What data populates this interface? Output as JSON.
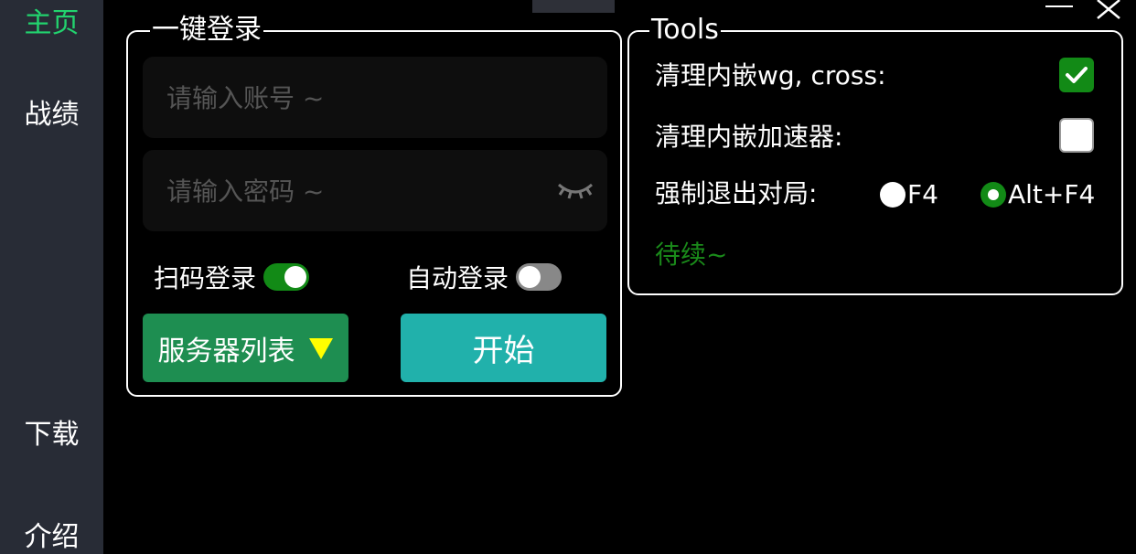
{
  "sidebar": {
    "items": [
      {
        "label": "主页",
        "active": true
      },
      {
        "label": "战绩",
        "active": false
      },
      {
        "label": "下载",
        "active": false
      },
      {
        "label": "介绍",
        "active": false
      }
    ]
  },
  "login": {
    "group_title": "一键登录",
    "account_placeholder": "请输入账号 ~",
    "password_placeholder": "请输入密码 ~",
    "qr_login_label": "扫码登录",
    "qr_login_on": true,
    "auto_login_label": "自动登录",
    "auto_login_on": false,
    "server_list_label": "服务器列表",
    "start_label": "开始"
  },
  "tools": {
    "group_title": "Tools",
    "clean_wg_label": "清理内嵌wg, cross:",
    "clean_wg_checked": true,
    "clean_accel_label": "清理内嵌加速器:",
    "clean_accel_checked": false,
    "force_quit_label": "强制退出对局:",
    "force_quit_options": [
      "F4",
      "Alt+F4"
    ],
    "force_quit_selected": "Alt+F4",
    "pending_label": "待续~"
  },
  "colors": {
    "accent_green": "#22d36e",
    "toggle_on": "#128a16",
    "server_button": "#1e8e51",
    "start_button": "#21b1ab",
    "arrow_yellow": "#ffff00"
  }
}
